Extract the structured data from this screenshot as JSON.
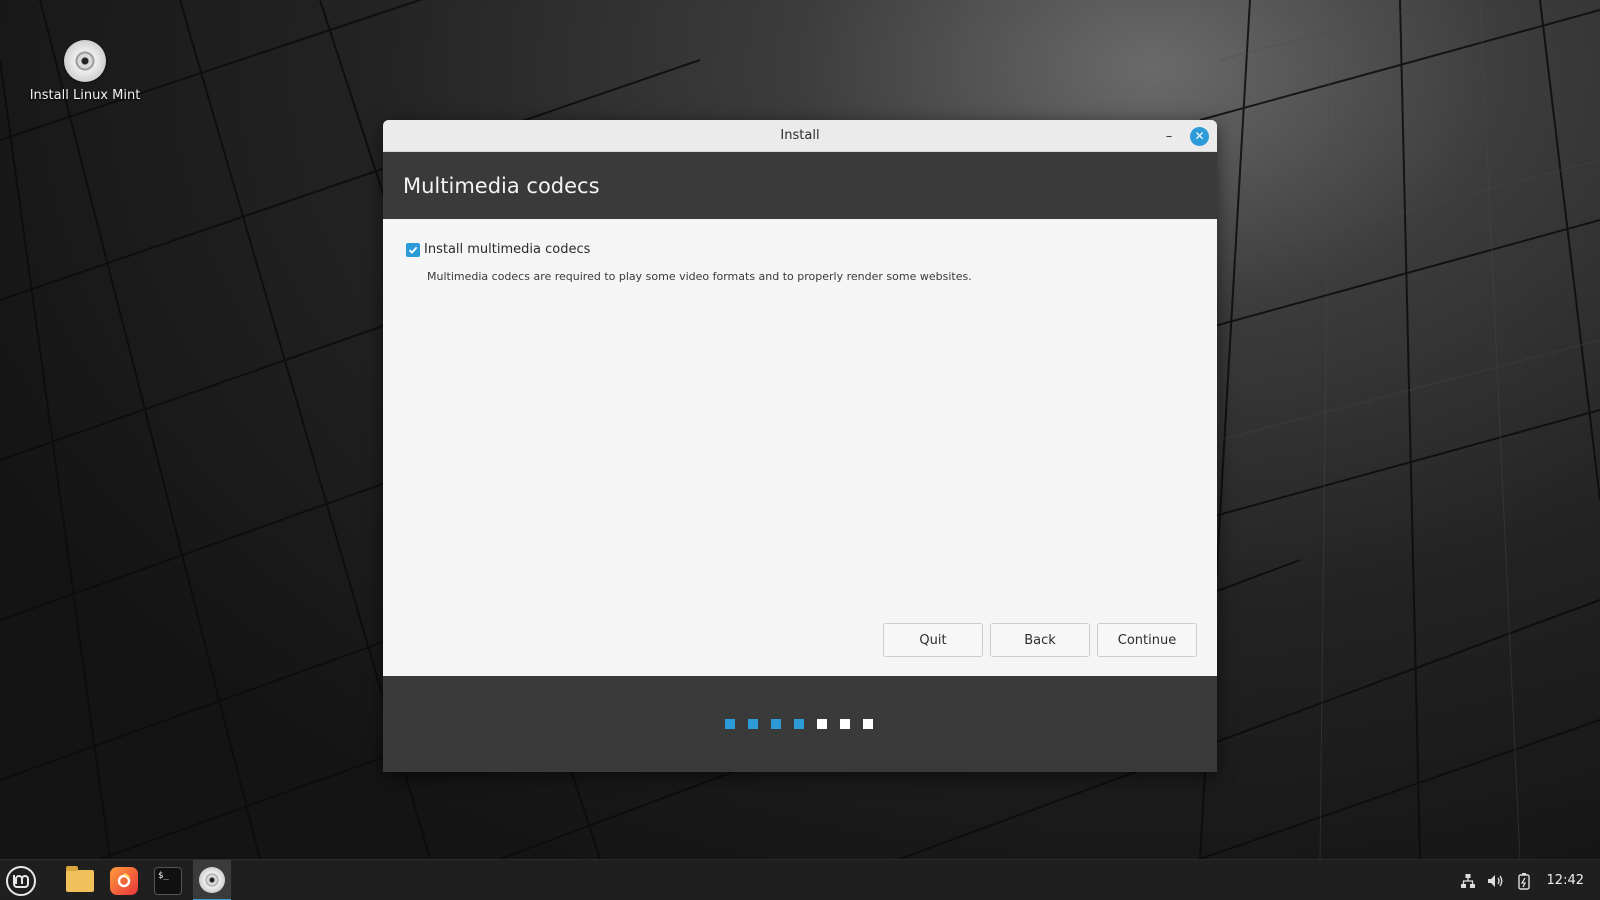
{
  "desktop": {
    "icons": [
      {
        "label": "Install Linux Mint",
        "icon": "disc-icon"
      }
    ]
  },
  "window": {
    "title": "Install",
    "header_title": "Multimedia codecs",
    "option": {
      "label": "Install multimedia codecs",
      "checked": true,
      "description": "Multimedia codecs are required to play some video formats and to properly render some websites."
    },
    "buttons": {
      "quit": "Quit",
      "back": "Back",
      "continue": "Continue"
    },
    "progress": {
      "total_steps": 7,
      "completed_steps": 4
    }
  },
  "taskbar": {
    "launchers": [
      "mint-menu-icon",
      "files-folder-icon",
      "firefox-icon",
      "terminal-icon",
      "installer-disc-icon"
    ],
    "tray": [
      "network-icon",
      "volume-icon",
      "power-icon"
    ],
    "clock": "12:42"
  },
  "colors": {
    "accent": "#2d9bd8",
    "header": "#3a3a3a",
    "pending_dot": "#ffffff"
  }
}
